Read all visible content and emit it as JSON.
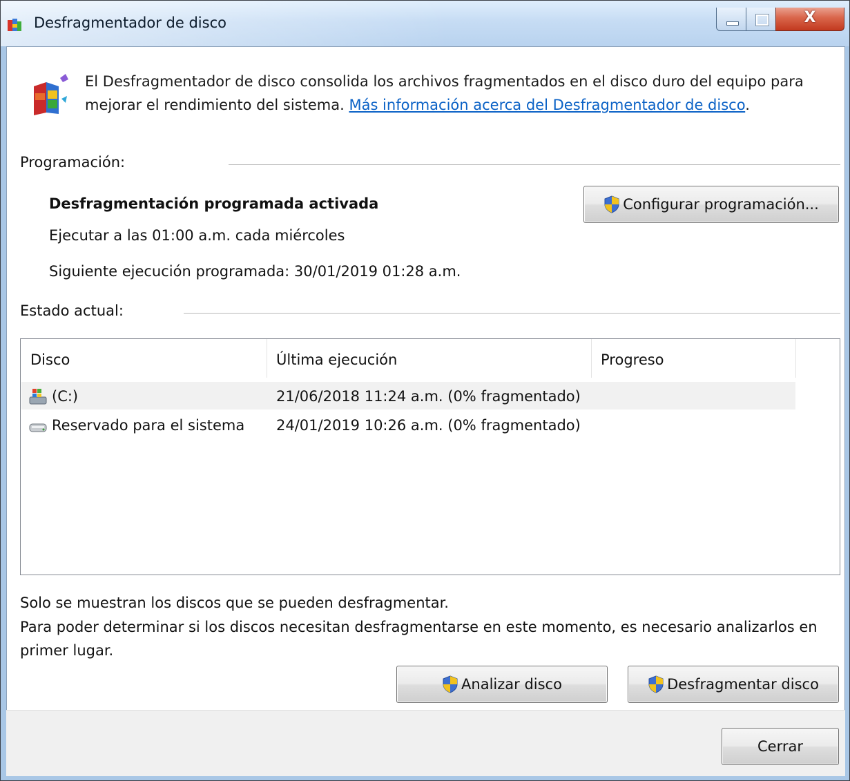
{
  "window": {
    "title": "Desfragmentador de disco",
    "controls": {
      "minimize": "",
      "maximize": "",
      "close": "X"
    }
  },
  "intro": {
    "text": "El Desfragmentador de disco consolida los archivos fragmentados en el disco duro del equipo para mejorar el rendimiento del sistema. ",
    "link": "Más información acerca del Desfragmentador de disco",
    "after_link": "."
  },
  "schedule": {
    "section_label": "Programación:",
    "status": "Desfragmentación programada activada",
    "run_at": "Ejecutar a las 01:00 a.m. cada miércoles",
    "next_run": "Siguiente ejecución programada: 30/01/2019 01:28 a.m.",
    "configure_button": "Configurar programación..."
  },
  "status": {
    "section_label": "Estado actual:",
    "columns": [
      "Disco",
      "Última ejecución",
      "Progreso"
    ],
    "rows": [
      {
        "disk": "(C:)",
        "last_run": "21/06/2018 11:24 a.m. (0% fragmentado)",
        "progress": "",
        "icon": "windows-drive-icon",
        "selected": true
      },
      {
        "disk": "Reservado para el sistema",
        "last_run": "24/01/2019 10:26 a.m. (0% fragmentado)",
        "progress": "",
        "icon": "hard-drive-icon",
        "selected": false
      }
    ]
  },
  "footer": {
    "note1": "Solo se muestran los discos que se pueden desfragmentar.",
    "note2": "Para poder determinar si los discos necesitan desfragmentarse en este momento, es necesario analizarlos en primer lugar.",
    "analyze_button": "Analizar disco",
    "defrag_button": "Desfragmentar disco",
    "close_button": "Cerrar"
  },
  "colors": {
    "link": "#0b62c6",
    "close_button": "#c2391f",
    "title_bar": "#c6dcf4"
  }
}
